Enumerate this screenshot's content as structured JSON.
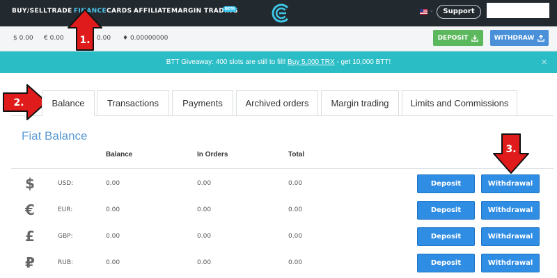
{
  "nav": {
    "items": [
      {
        "label": "BUY/SELL",
        "active": false
      },
      {
        "label": "TRADE",
        "active": false
      },
      {
        "label": "FINANCE",
        "active": true
      },
      {
        "label": "CARDS",
        "active": false
      },
      {
        "label": "AFFILIATE",
        "active": false
      },
      {
        "label": "MARGIN TRADING",
        "active": false
      }
    ],
    "beta_badge": "BETA",
    "support_label": "Support",
    "accent_color": "#4fc3e8"
  },
  "balances": [
    {
      "symbol": "$",
      "value": "0.00"
    },
    {
      "symbol": "€",
      "value": "0.00"
    },
    {
      "symbol": "",
      "value": "0.00"
    },
    {
      "symbol": "♦",
      "value": "0.00000000"
    }
  ],
  "top_actions": {
    "deposit_label": "DEPOSIT",
    "withdraw_label": "WITHDRAW"
  },
  "banner": {
    "text_before": "BTT Giveaway: 400 slots are still to fill! ",
    "link_text": "Buy 5,000 TRX",
    "text_after": " - get 10,000 BTT!",
    "close": "×"
  },
  "tabs": [
    {
      "label": "Balance",
      "active": true
    },
    {
      "label": "Transactions",
      "active": false
    },
    {
      "label": "Payments",
      "active": false
    },
    {
      "label": "Archived orders",
      "active": false
    },
    {
      "label": "Margin trading",
      "active": false
    },
    {
      "label": "Limits and Commissions",
      "active": false
    }
  ],
  "fiat": {
    "title": "Fiat Balance",
    "headers": {
      "balance": "Balance",
      "in_orders": "In Orders",
      "total": "Total"
    },
    "rows": [
      {
        "icon": "$",
        "currency": "USD:",
        "balance": "0.00",
        "in_orders": "0.00",
        "total": "0.00",
        "deposit": "Deposit",
        "withdrawal": "Withdrawal"
      },
      {
        "icon": "€",
        "currency": "EUR:",
        "balance": "0.00",
        "in_orders": "0.00",
        "total": "0.00",
        "deposit": "Deposit",
        "withdrawal": "Withdrawal"
      },
      {
        "icon": "£",
        "currency": "GBP:",
        "balance": "0.00",
        "in_orders": "0.00",
        "total": "0.00",
        "deposit": "Deposit",
        "withdrawal": "Withdrawal"
      },
      {
        "icon": "₽",
        "currency": "RUB:",
        "balance": "0.00",
        "in_orders": "0.00",
        "total": "0.00",
        "deposit": "Deposit",
        "withdrawal": "Withdrawal"
      }
    ]
  },
  "annotations": [
    "1.",
    "2.",
    "3."
  ]
}
